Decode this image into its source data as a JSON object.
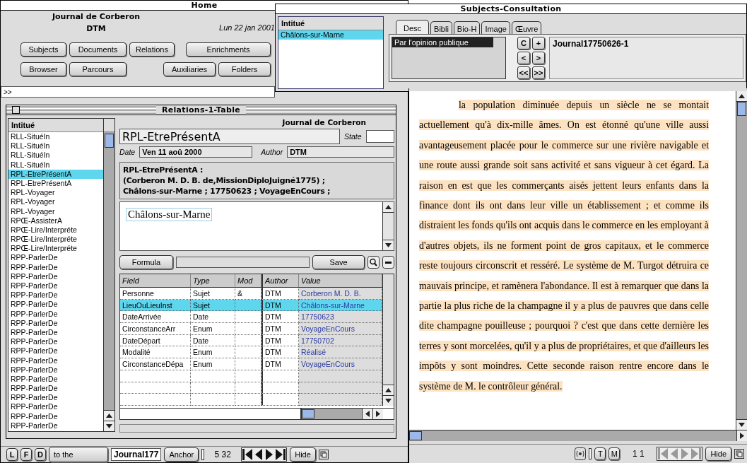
{
  "home_window": {
    "title": "Home",
    "journal": "Journal de Corberon",
    "user": "DTM",
    "date": "Lun 22 jan 2001",
    "buttons_row_1": [
      "Subjects",
      "Documents",
      "Relations",
      "Enrichments"
    ],
    "buttons_row_2": [
      "Browser",
      "Parcours",
      "Auxiliaries",
      "Folders"
    ],
    "command_field": ">>",
    "bottom_bar": {
      "letter_buttons": [
        "L",
        "F",
        "D"
      ],
      "overlapped_text": "to the",
      "journal_field": "Journal177",
      "anchor_button": "Anchor",
      "counter": "5 32",
      "hide_button": "Hide"
    }
  },
  "subjects_window": {
    "title": "Subjects-Consultation",
    "list_header": "Intitué",
    "list_items": [
      {
        "label": "Châlons-sur-Marne",
        "selected": true
      }
    ],
    "tabs": [
      {
        "label": "Desc",
        "selected": true
      },
      {
        "label": "Bibli",
        "selected": false
      },
      {
        "label": "Bio-H",
        "selected": false
      },
      {
        "label": "Image",
        "selected": false
      },
      {
        "label": "Œuvre",
        "selected": false
      }
    ],
    "descriptor_list": [
      {
        "label": "Par l'opinion publique",
        "selected": true
      }
    ],
    "nav_buttons": [
      "C",
      "+",
      "<",
      ">",
      "<<",
      ">>"
    ],
    "reference_field": "Journal17750626-1",
    "document_text": "la population diminuée depuis un siècle ne se montait actuellement qu'à dix-mille âmes. On est étonné qu'une ville aussi avantageusement placée pour le commerce sur une rivière navigable et une route aussi grande soit sans activité et sans vigueur à cet égard. La raison en est que les commerçants aisés jettent leurs enfants dans la finance dont ils ont dans leur ville un établissement ; et comme ils distraient les fonds qu'ils ont acquis dans le commerce en les employant à d'autres objets, ils ne forment point de gros capitaux, et le commerce reste toujours circonscrit et resséré. Le système de M. Turgot détruira ce mauvais principe, et ramènera l'abondance. Il est à remarquer que dans la partie la plus riche de la champagne il y a plus de pauvres que dans celle dite champagne pouilleuse ; pourquoi ? c'est que dans cette dernière les terres y sont morcelées, qu'il y a plus de propriétaires, et que d'ailleurs les impôts y sont moindres. Cette seconde raison rentre encore dans le système de M. le contrôleur général.",
    "bottom_bar": {
      "tool_buttons": [
        "T",
        "M"
      ],
      "counter": "1 1",
      "hide_button": "Hide"
    }
  },
  "relations_window": {
    "title": "Relations-1-Table",
    "list_header": "Intitué",
    "list_items": [
      {
        "label": "RLL-SituéIn",
        "selected": false
      },
      {
        "label": "RLL-SituéIn",
        "selected": false
      },
      {
        "label": "RLL-SituéIn",
        "selected": false
      },
      {
        "label": "RLL-SituéIn",
        "selected": false
      },
      {
        "label": "RPL-EtrePrésentA",
        "selected": true
      },
      {
        "label": "RPL-EtrePrésentA",
        "selected": false
      },
      {
        "label": "RPL-Voyager",
        "selected": false
      },
      {
        "label": "RPL-Voyager",
        "selected": false
      },
      {
        "label": "RPL-Voyager",
        "selected": false
      },
      {
        "label": "RPŒ-AssisterA",
        "selected": false
      },
      {
        "label": "RPŒ-Lire/Interpréte",
        "selected": false
      },
      {
        "label": "RPŒ-Lire/Interpréte",
        "selected": false
      },
      {
        "label": "RPŒ-Lire/Interpréte",
        "selected": false
      },
      {
        "label": "RPP-ParlerDe",
        "selected": false
      },
      {
        "label": "RPP-ParlerDe",
        "selected": false
      },
      {
        "label": "RPP-ParlerDe",
        "selected": false
      },
      {
        "label": "RPP-ParlerDe",
        "selected": false
      },
      {
        "label": "RPP-ParlerDe",
        "selected": false
      },
      {
        "label": "RPP-ParlerDe",
        "selected": false
      },
      {
        "label": "RPP-ParlerDe",
        "selected": false
      },
      {
        "label": "RPP-ParlerDe",
        "selected": false
      },
      {
        "label": "RPP-ParlerDe",
        "selected": false
      },
      {
        "label": "RPP-ParlerDe",
        "selected": false
      },
      {
        "label": "RPP-ParlerDe",
        "selected": false
      },
      {
        "label": "RPP-ParlerDe",
        "selected": false
      },
      {
        "label": "RPP-ParlerDe",
        "selected": false
      },
      {
        "label": "RPP-ParlerDe",
        "selected": false
      },
      {
        "label": "RPP-ParlerDe",
        "selected": false
      },
      {
        "label": "RPP-ParlerDe",
        "selected": false
      },
      {
        "label": "RPP-ParlerDe",
        "selected": false
      },
      {
        "label": "RPP-ParlerDe",
        "selected": false
      },
      {
        "label": "RPP-ParlerDe",
        "selected": false
      }
    ],
    "journal": "Journal de Corberon",
    "name": "RPL-EtrePrésentA",
    "state_label": "State",
    "date_label": "Date",
    "date": "Ven 11 aoû 2000",
    "author_label": "Author",
    "author": "DTM",
    "summary_lines": [
      "RPL-EtrePrésentA :",
      "(Corberon M. D. B. de,MissionDiploJuigné1775) ;",
      "Châlons-sur-Marne  ; 17750623  ; VoyageEnCours  ;"
    ],
    "note_value": "Châlons-sur-Marne",
    "formula_button": "Formula",
    "save_button": "Save",
    "table": {
      "columns": [
        "Field",
        "Type",
        "Mod",
        "Author",
        "Value"
      ],
      "rows": [
        {
          "field": "Personne",
          "type": "Sujet",
          "mod": "&",
          "author": "DTM",
          "value": "Corberon M. D. B.",
          "selected": false
        },
        {
          "field": "LieuOuLieuInst",
          "type": "Sujet",
          "mod": "",
          "author": "DTM",
          "value": "Châlons-sur-Marne",
          "selected": true
        },
        {
          "field": "DateArrivée",
          "type": "Date",
          "mod": "",
          "author": "DTM",
          "value": "17750623",
          "selected": false
        },
        {
          "field": "CirconstanceArr",
          "type": "Enum",
          "mod": "",
          "author": "DTM",
          "value": "VoyageEnCours",
          "selected": false
        },
        {
          "field": "DateDépart",
          "type": "Date",
          "mod": "",
          "author": "DTM",
          "value": "17750702",
          "selected": false
        },
        {
          "field": "Modalité",
          "type": "Enum",
          "mod": "",
          "author": "DTM",
          "value": "Réalisé",
          "selected": false
        },
        {
          "field": "CirconstanceDépa",
          "type": "Enum",
          "mod": "",
          "author": "DTM",
          "value": "VoyageEnCours",
          "selected": false
        }
      ]
    }
  }
}
